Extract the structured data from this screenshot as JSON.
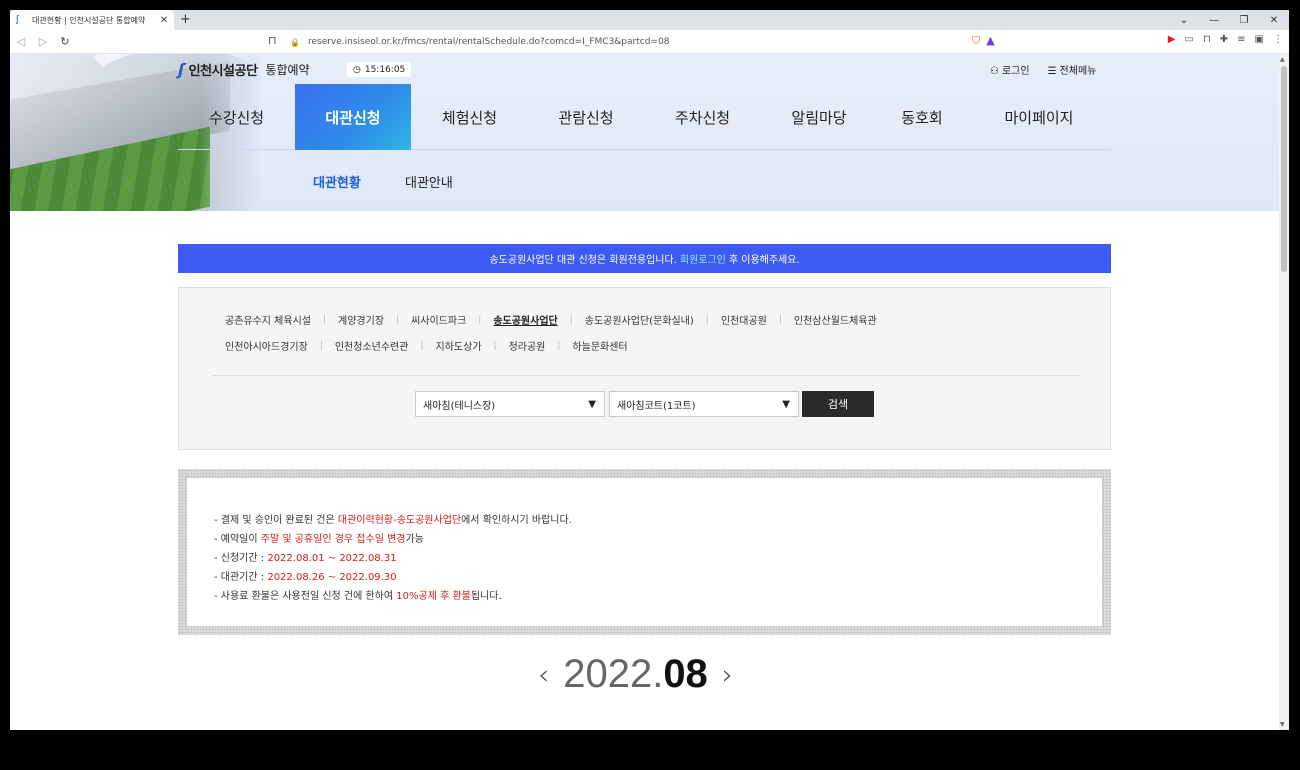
{
  "browser": {
    "tab_title": "대관현황 | 인천시설공단 통합예약",
    "tab_close": "✕",
    "new_tab": "+",
    "url": "reserve.insiseol.or.kr/fmcs/rental/rentalSchedule.do?comcd=I_FMC3&partcd=08",
    "window_controls": [
      "⌄",
      "—",
      "❐",
      "✕"
    ]
  },
  "header": {
    "logo_name": "인천시설공단",
    "logo_sub": "통합예약",
    "clock_time": "15:16:05",
    "login_label": "로그인",
    "all_menu_label": "전체메뉴"
  },
  "gnb": {
    "items": [
      {
        "label": "수강신청"
      },
      {
        "label": "대관신청"
      },
      {
        "label": "체험신청"
      },
      {
        "label": "관람신청"
      },
      {
        "label": "주차신청"
      },
      {
        "label": "알림마당"
      },
      {
        "label": "동호회"
      },
      {
        "label": "마이페이지"
      }
    ],
    "active_index": 1
  },
  "lnb": {
    "items": [
      {
        "label": "대관현황"
      },
      {
        "label": "대관안내"
      }
    ]
  },
  "notice": {
    "before": "송도공원사업단 대관 신청은 회원전용입니다.",
    "link": "회원로그인",
    "after": "후 이용해주세요."
  },
  "facilities": {
    "row1": [
      "공촌유수지 체육시설",
      "계양경기장",
      "씨사이드파크",
      "송도공원사업단",
      "송도공원사업단(문화실내)",
      "인천대공원",
      "인천삼산월드체육관"
    ],
    "row2": [
      "인천아시아드경기장",
      "인천청소년수련관",
      "지하도상가",
      "청라공원",
      "하늘문화센터"
    ],
    "active": "송도공원사업단"
  },
  "search": {
    "select1_value": "새아침(테니스장)",
    "select2_value": "새아침코트(1코트)",
    "button_label": "검색"
  },
  "info": {
    "line1_pre": "- 결제 및 승인이 완료된 건은 ",
    "line1_red": "대관이력현황-송도공원사업단",
    "line1_post": "에서 확인하시기 바랍니다.",
    "line2_pre": "- 예약일이 ",
    "line2_red": "주말 및 공휴일인 경우 접수일 변경",
    "line2_post": "가능",
    "line3_pre": "- 신청기간 : ",
    "line3_red": "2022.08.01 ~ 2022.08.31",
    "line4_pre": "- 대관기간 : ",
    "line4_red": "2022.08.26 ~ 2022.09.30",
    "line5_pre": "- 사용료 환불은 사용전일 신청 건에 한하여 ",
    "line5_red": "10%공제 후 환불",
    "line5_post": "됩니다."
  },
  "calendar": {
    "year_part": "2022.",
    "month_part": "08",
    "prev": "‹",
    "next": "›"
  },
  "colors": {
    "accent_blue": "#3d5bf0",
    "active_menu": "#2e8de8",
    "highlight_red": "#d21b1b"
  }
}
